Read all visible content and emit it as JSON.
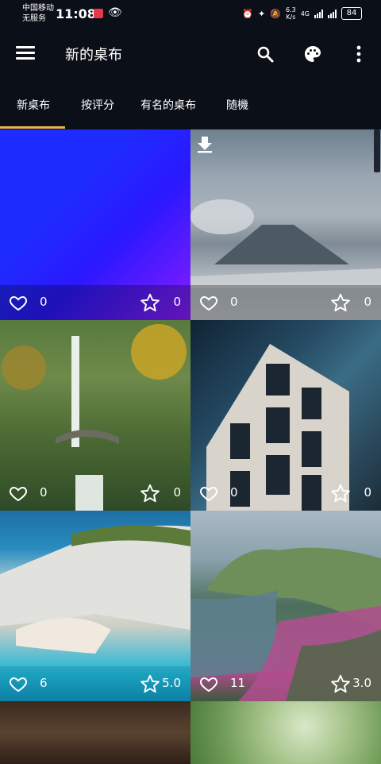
{
  "status_bar": {
    "carrier_line1": "中国移动",
    "carrier_line2": "无服务",
    "time": "11:08",
    "net_speed_value": "6.3",
    "net_speed_unit": "K/s",
    "network_type": "4G",
    "battery": "84"
  },
  "app_bar": {
    "title": "新的桌布",
    "icons": [
      "menu-icon",
      "search-icon",
      "palette-icon",
      "more-vert-icon"
    ]
  },
  "tabs": [
    {
      "label": "新桌布",
      "selected": true
    },
    {
      "label": "按评分",
      "selected": false
    },
    {
      "label": "有名的桌布",
      "selected": false
    },
    {
      "label": "随機",
      "selected": false
    }
  ],
  "accent_color": "#e8b34a",
  "wallpapers": [
    {
      "image": "blue-purple-gradient",
      "likes": "0",
      "rating": "0"
    },
    {
      "image": "volcano-landscape",
      "likes": "0",
      "rating": "0",
      "downloaded": true
    },
    {
      "image": "waterfall-bridge",
      "likes": "0",
      "rating": "0"
    },
    {
      "image": "glass-building",
      "likes": "0",
      "rating": "0"
    },
    {
      "image": "shipwreck-beach",
      "likes": "6",
      "rating": "5.0"
    },
    {
      "image": "coastal-cliffs",
      "likes": "11",
      "rating": "3.0"
    },
    {
      "image": "sand-ripples"
    },
    {
      "image": "green-bokeh"
    }
  ]
}
